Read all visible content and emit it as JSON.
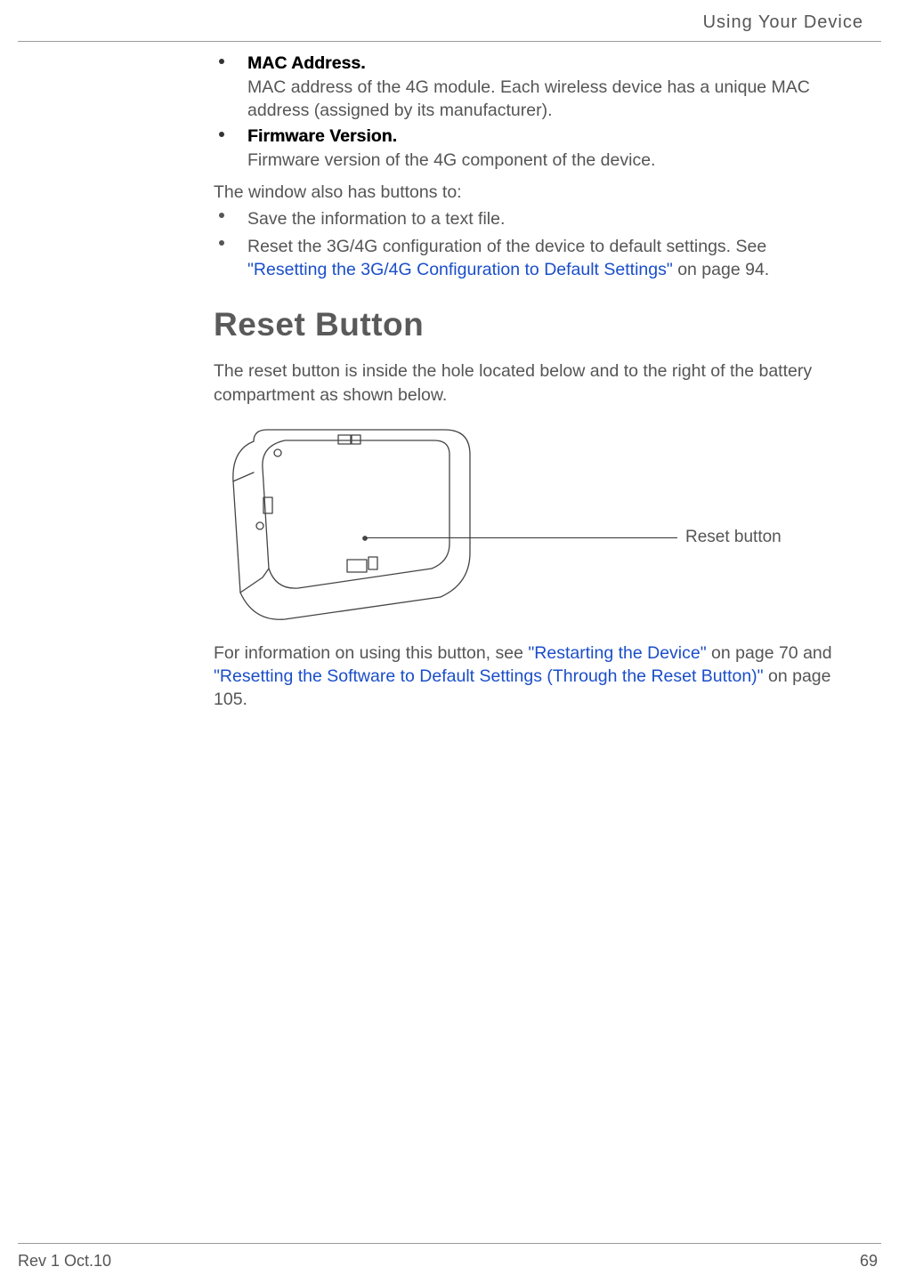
{
  "header": {
    "title": "Using Your Device"
  },
  "items": [
    {
      "term": "MAC Address",
      "desc": "MAC address of the 4G module. Each wireless device has a unique MAC address (assigned by its manufacturer)."
    },
    {
      "term": "Firmware Version",
      "desc": "Firmware version of the 4G component of the device."
    }
  ],
  "intro2": "The window also has buttons to:",
  "actions": [
    {
      "text": "Save the information to a text file."
    },
    {
      "text_prefix": "Reset the 3G/4G configuration of the device to default settings. See ",
      "link": "\"Resetting the 3G/4G Configuration to Default Settings\"",
      "text_suffix": " on page 94."
    }
  ],
  "section_heading": "Reset Button",
  "section_para": "The reset button is inside the hole located below and to the right of the battery compartment as shown below.",
  "figure": {
    "callout": "Reset button"
  },
  "closing": {
    "prefix": "For information on using this button, see ",
    "link1": "\"Restarting the Device\"",
    "mid1": " on page 70 and ",
    "link2": "\"Resetting the Software to Default Settings (Through the Reset Button)\"",
    "suffix": " on page 105."
  },
  "footer": {
    "left": "Rev 1  Oct.10",
    "right": "69"
  }
}
